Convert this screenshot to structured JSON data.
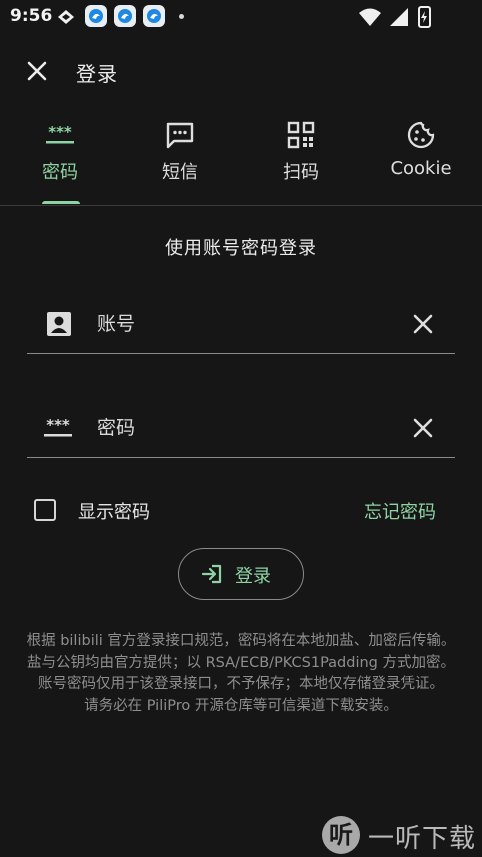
{
  "status_bar": {
    "time": "9:56",
    "app_icons": [
      "bird-app-icon",
      "bird-app-icon",
      "bird-app-icon"
    ],
    "right_icons": [
      "wifi-icon",
      "signal-icon",
      "battery-charging-icon"
    ]
  },
  "app_bar": {
    "close_icon": "close-icon",
    "title": "登录"
  },
  "tabs": [
    {
      "label": "密码",
      "icon": "password-dots-icon",
      "active": true
    },
    {
      "label": "短信",
      "icon": "message-icon",
      "active": false
    },
    {
      "label": "扫码",
      "icon": "qr-code-icon",
      "active": false
    },
    {
      "label": "Cookie",
      "icon": "cookie-icon",
      "active": false
    }
  ],
  "form": {
    "subtitle": "使用账号密码登录",
    "account": {
      "placeholder": "账号",
      "value": "",
      "icon": "account-box-icon"
    },
    "password": {
      "placeholder": "密码",
      "value": "",
      "icon": "password-dots-icon"
    },
    "show_password": {
      "label": "显示密码",
      "checked": false
    },
    "forgot_password": "忘记密码",
    "login_button": "登录"
  },
  "notes": [
    "根据 bilibili 官方登录接口规范，密码将在本地加盐、加密后传输。",
    "盐与公钥均由官方提供；以 RSA/ECB/PKCS1Padding 方式加密。",
    "账号密码仅用于该登录接口，不予保存；本地仅存储登录凭证。",
    "请务必在 PiliPro 开源仓库等可信渠道下载安装。"
  ],
  "watermark": {
    "logo_char": "听",
    "text": "一听下载"
  },
  "colors": {
    "accent": "#8fd3a4",
    "background": "#161616",
    "divider": "#3a3a3a"
  }
}
